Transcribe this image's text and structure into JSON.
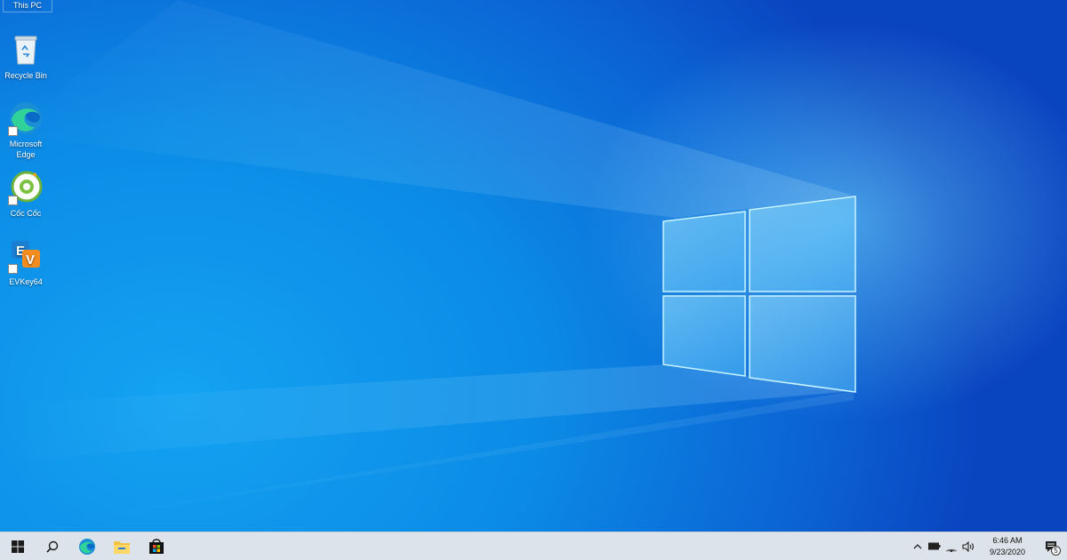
{
  "desktop": {
    "icons": [
      {
        "label": "This PC"
      },
      {
        "label": "Recycle Bin"
      },
      {
        "label": "Microsoft Edge"
      },
      {
        "label": "Cốc Cốc"
      },
      {
        "label": "EVKey64"
      }
    ]
  },
  "taskbar": {
    "start_icon": "windows-logo-icon",
    "search_icon": "search-icon",
    "pinned_apps": [
      "edge-icon",
      "file-explorer-icon",
      "microsoft-store-icon"
    ],
    "tray": {
      "icons": [
        "chevron-up-icon",
        "battery-icon",
        "wifi-icon",
        "volume-icon"
      ],
      "time": "6:46 AM",
      "date": "9/23/2020",
      "notification_count": "5"
    }
  },
  "colors": {
    "wallpaper_blue": "#0b8be6",
    "taskbar_bg": "#dde3ea"
  }
}
